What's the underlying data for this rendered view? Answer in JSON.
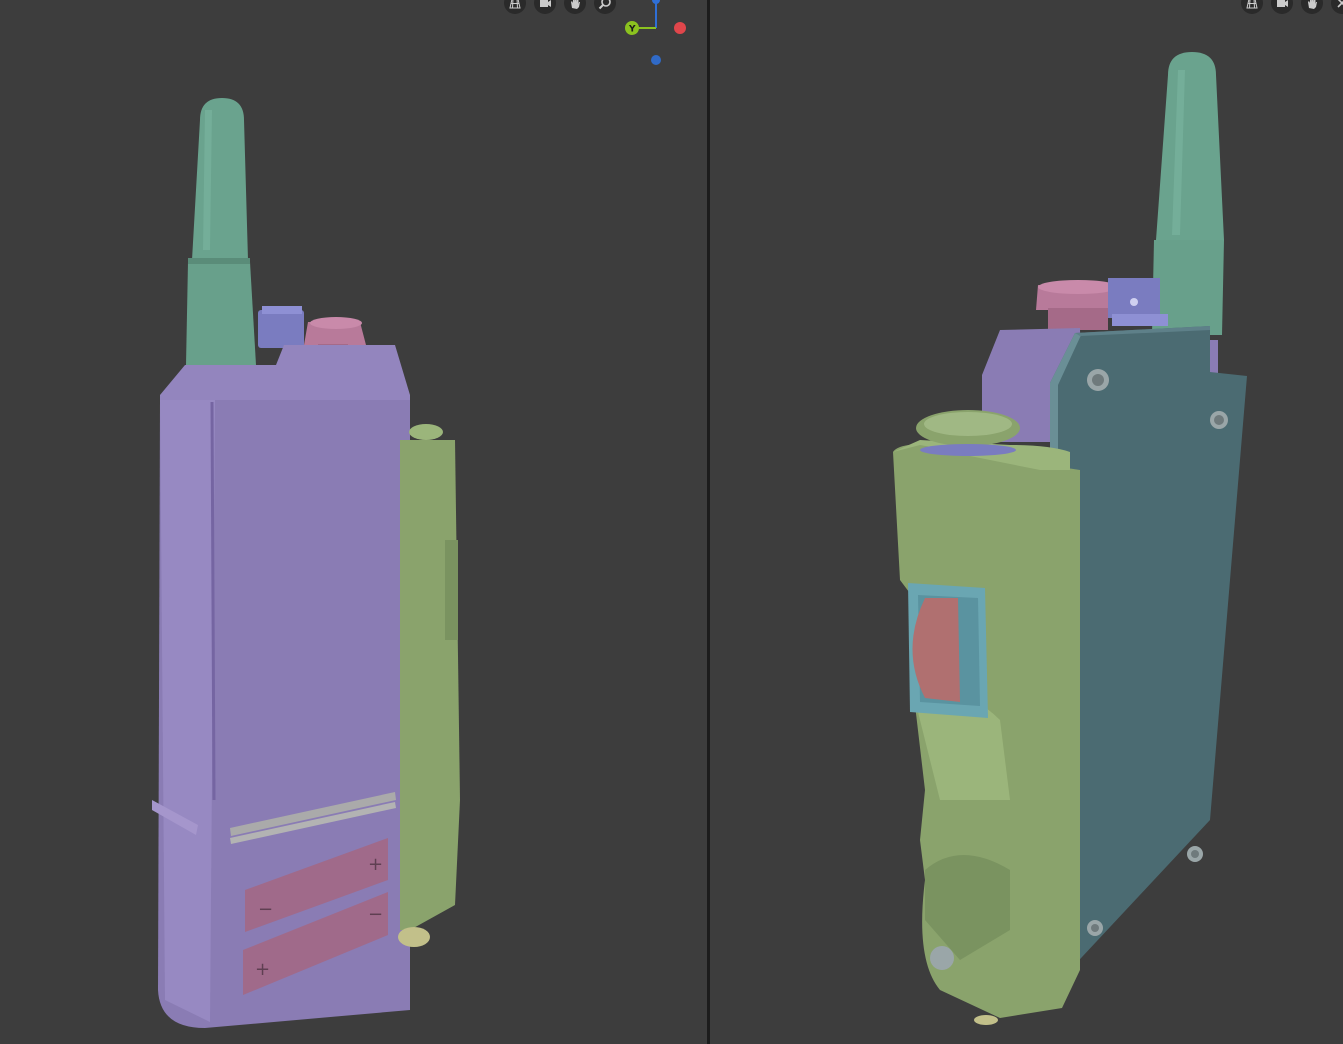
{
  "viewports": {
    "left": {
      "nav_tools": [
        "grid-view-icon",
        "camera-icon",
        "hand-pan-icon",
        "zoom-icon"
      ],
      "gizmo": {
        "y_label": "Y",
        "colors": {
          "x": "#e0464b",
          "y": "#8bc21f",
          "z": "#2f6fd6"
        }
      }
    },
    "right": {
      "nav_tools": [
        "grid-view-icon",
        "camera-icon",
        "hand-pan-icon",
        "close-icon"
      ]
    }
  },
  "palette": {
    "background": "#3d3d3d",
    "splitter": "#1c1c1c",
    "antenna": "#6aa38e",
    "body_purple": "#8a7cb4",
    "side_green": "#8aa36c",
    "back_panel_teal": "#4b6b72",
    "knob_pink": "#b87a9a",
    "knob_blue": "#7a7cc0",
    "battery_label": "#a06a8a",
    "button_red": "#b07070",
    "button_frame": "#6aa6b2"
  },
  "battery_labels": {
    "plus": "+",
    "minus": "−"
  }
}
